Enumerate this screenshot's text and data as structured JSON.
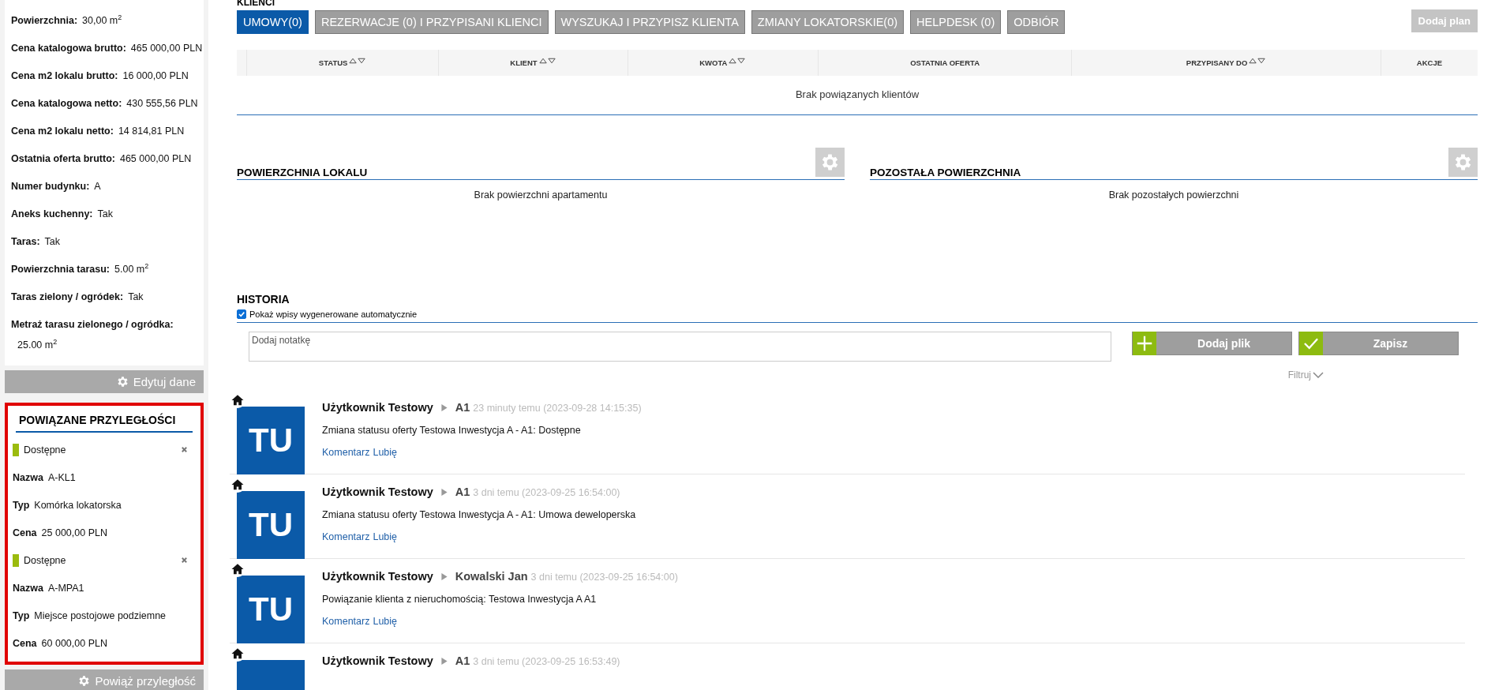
{
  "details": [
    {
      "label": "Powierzchnia:",
      "value": "30,00 m$^{2}$"
    },
    {
      "label": "Cena katalogowa brutto:",
      "value": "465 000,00 PLN"
    },
    {
      "label": "Cena m2 lokalu brutto:",
      "value": "16 000,00 PLN"
    },
    {
      "label": "Cena katalogowa netto:",
      "value": "430 555,56 PLN"
    },
    {
      "label": "Cena m2 lokalu netto:",
      "value": "14 814,81 PLN"
    },
    {
      "label": "Ostatnia oferta brutto:",
      "value": "465 000,00 PLN"
    },
    {
      "label": "Numer budynku:",
      "value": "A"
    },
    {
      "label": "Aneks kuchenny:",
      "value": "Tak"
    },
    {
      "label": "Taras:",
      "value": "Tak"
    },
    {
      "label": "Powierzchnia tarasu:",
      "value": "5.00 m$^{2}$"
    },
    {
      "label": "Taras zielony / ogródek:",
      "value": "Tak"
    },
    {
      "label": "Metraż tarasu zielonego / ogródka:",
      "value": "25.00 m$^{2}$",
      "wrap": true
    }
  ],
  "edit_button": "Edytuj dane",
  "adjacent": {
    "title": "POWIĄZANE PRZYLEGŁOŚCI",
    "highlighted": true,
    "items": [
      {
        "status": "Dostępne",
        "color": "#9bbb0e",
        "fields": [
          {
            "label": "Nazwa",
            "value": "A-KL1"
          },
          {
            "label": "Typ",
            "value": "Komórka lokatorska"
          },
          {
            "label": "Cena",
            "value": "25 000,00 PLN"
          }
        ]
      },
      {
        "status": "Dostępne",
        "color": "#9bbb0e",
        "fields": [
          {
            "label": "Nazwa",
            "value": "A-MPA1"
          },
          {
            "label": "Typ",
            "value": "Miejsce postojowe podziemne"
          },
          {
            "label": "Cena",
            "value": "60 000,00 PLN"
          }
        ]
      }
    ]
  },
  "link_button": "Powiąż przyległość",
  "clients": {
    "title": "KLIENCI",
    "tabs": [
      {
        "label": "UMOWY(0)",
        "selected": true
      },
      {
        "label": "REZERWACJE (0) I PRZYPISANI KLIENCI",
        "selected": false
      },
      {
        "label": "WYSZUKAJ I PRZYPISZ KLIENTA",
        "selected": false
      },
      {
        "label": "ZMIANY LOKATORSKIE(0)",
        "selected": false
      },
      {
        "label": "HELPDESK (0)",
        "selected": false
      },
      {
        "label": "ODBIÓR",
        "selected": false
      }
    ],
    "add_plan_button": "Dodaj plan",
    "columns": [
      {
        "label": "STATUS",
        "sortable": true
      },
      {
        "label": "KLIENT",
        "sortable": true
      },
      {
        "label": "KWOTA",
        "sortable": true
      },
      {
        "label": "OSTATNIA OFERTA",
        "sortable": false
      },
      {
        "label": "PRZYPISANY DO",
        "sortable": true
      },
      {
        "label": "AKCJE",
        "sortable": false
      }
    ],
    "empty_text": "Brak powiązanych klientów"
  },
  "areas": [
    {
      "title": "POWIERZCHNIA LOKALU",
      "empty_text": "Brak powierzchni apartamentu"
    },
    {
      "title": "POZOSTAŁA POWIERZCHNIA",
      "empty_text": "Brak pozostałych powierzchni"
    }
  ],
  "history": {
    "title": "HISTORIA",
    "auto_entries": {
      "label": "Pokaż wpisy wygenerowane automatycznie",
      "checked": true
    },
    "note": {
      "placeholder": "Dodaj notatkę"
    },
    "add_file_button": "Dodaj plik",
    "save_button": "Zapisz",
    "filter": "Filtruj",
    "entries": [
      {
        "avatar": "TU",
        "author": "Użytkownik Testowy",
        "target": "A1",
        "time": "23 minuty temu (2023-09-28 14:15:35)",
        "text": "Zmiana statusu oferty Testowa Inwestycja A - A1: Dostępne",
        "actions": [
          "Komentarz",
          "Lubię"
        ]
      },
      {
        "avatar": "TU",
        "author": "Użytkownik Testowy",
        "target": "A1",
        "time": "3 dni temu (2023-09-25 16:54:00)",
        "text": "Zmiana statusu oferty Testowa Inwestycja A - A1: Umowa deweloperska",
        "actions": [
          "Komentarz",
          "Lubię"
        ]
      },
      {
        "avatar": "TU",
        "author": "Użytkownik Testowy",
        "target": "Kowalski Jan",
        "time": "3 dni temu (2023-09-25 16:54:00)",
        "text": "Powiązanie klienta z nieruchomością: Testowa Inwestycja A A1",
        "actions": [
          "Komentarz",
          "Lubię"
        ]
      },
      {
        "author": "Użytkownik Testowy",
        "target": "A1",
        "time": "3 dni temu (2023-09-25 16:53:49)"
      }
    ]
  }
}
